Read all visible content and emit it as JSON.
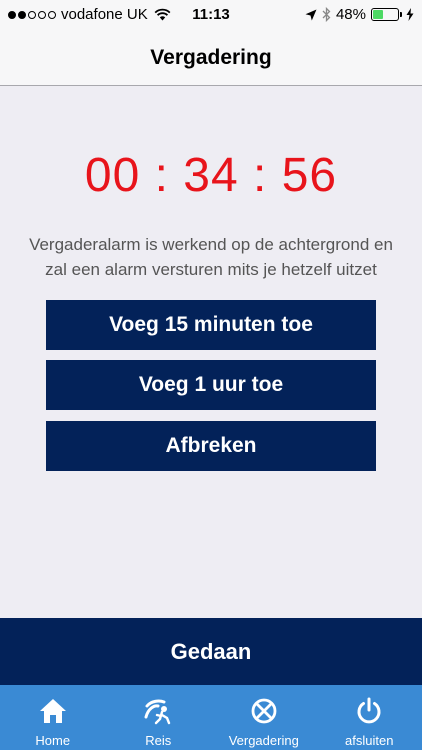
{
  "status_bar": {
    "carrier": "vodafone UK",
    "time": "11:13",
    "battery_percent": "48%",
    "battery_level": 0.48,
    "icons": [
      "signal-dots-icon",
      "wifi-icon",
      "location-arrow-icon",
      "bluetooth-icon",
      "battery-icon",
      "charging-bolt-icon"
    ]
  },
  "navbar": {
    "title": "Vergadering"
  },
  "timer": {
    "value": "00 : 34 : 56",
    "color": "#e8141b"
  },
  "message": {
    "line1": "Vergaderalarm is werkend op de achtergrond en",
    "line2": "zal een alarm versturen mits je hetzelf uitzet"
  },
  "buttons": {
    "add_15": "Voeg 15 minuten toe",
    "add_hour": "Voeg 1 uur toe",
    "cancel": "Afbreken"
  },
  "done": {
    "label": "Gedaan"
  },
  "tabbar": {
    "items": [
      {
        "label": "Home",
        "icon": "home-icon"
      },
      {
        "label": "Reis",
        "icon": "travel-icon"
      },
      {
        "label": "Vergadering",
        "icon": "meeting-icon"
      },
      {
        "label": "afsluiten",
        "icon": "power-icon"
      }
    ]
  },
  "colors": {
    "accent": "#032259",
    "tabbar": "#3a8ad4",
    "background": "#eeedf3"
  }
}
